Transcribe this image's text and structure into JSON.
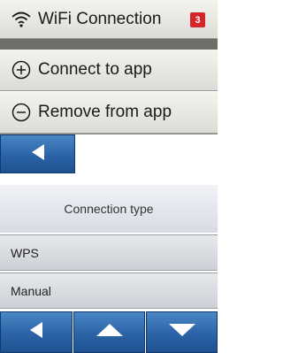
{
  "menu": {
    "wifi": {
      "label": "WiFi Connection",
      "icon": "wifi-icon",
      "badge": "3",
      "badge_color": "#d4252a"
    },
    "connect": {
      "label": "Connect to app",
      "icon": "plus-circle-icon"
    },
    "remove": {
      "label": "Remove from app",
      "icon": "minus-circle-icon"
    }
  },
  "connection": {
    "header": "Connection type",
    "options": [
      "WPS",
      "Manual"
    ]
  },
  "colors": {
    "button_blue": "#2a63a6"
  }
}
